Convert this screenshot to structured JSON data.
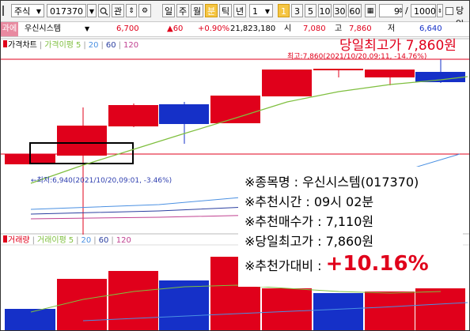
{
  "toolbar": {
    "market_label": "주식",
    "code": "017370",
    "search_icon": "magnifier-icon",
    "gwan_label": "관",
    "period_buttons": [
      "일",
      "주",
      "월",
      "분",
      "틱",
      "년"
    ],
    "active_period": "분",
    "interval_value": "1",
    "interval_buttons": [
      "1",
      "3",
      "5",
      "10",
      "30",
      "60"
    ],
    "active_interval": "1",
    "count_value": "9",
    "total_value": "1000",
    "same_day_label": "당일"
  },
  "info": {
    "tag": "과에",
    "name": "우신시스템",
    "price": "6,700",
    "change": "▲60",
    "rate": "+0.90%",
    "volume": "21,823,180",
    "t_label": "시",
    "open": "7,080",
    "h_label": "고",
    "high": "7,860",
    "l_label": "저",
    "low": "6,640"
  },
  "price_legend": {
    "title": "가격차트",
    "ma_label": "가격이평",
    "ma": [
      "5",
      "20",
      "60",
      "120"
    ]
  },
  "volume_legend": {
    "title": "거래량",
    "ma_label": "거래이평",
    "ma": [
      "5",
      "20",
      "60",
      "120"
    ]
  },
  "annotations": {
    "headline": "당일최고가 7,860원",
    "peak": "최고:7,860(2021/10/20,09:11, -14.76%)",
    "trough": "←최저:6,940(2021/10/20,09:01, -3.46%)"
  },
  "summary": {
    "stock": "※종목명 : 우신시스템(017370)",
    "time": "※추천시간 : 09시 02분",
    "buy_price": "※추천매수가 : 7,110원",
    "day_high": "※당일최고가 : 7,860원",
    "ratio_label": "※추천가대비 : ",
    "ratio_value": "+10.16%"
  },
  "colors": {
    "up": "#e0001b",
    "down": "#1530c8",
    "ma5": "#7fbf3f",
    "ma20": "#4a90e2",
    "ma60": "#2b3fa0",
    "ma120": "#c04090"
  }
}
